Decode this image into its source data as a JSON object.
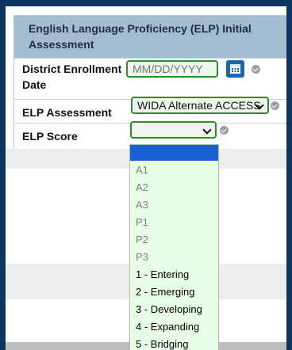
{
  "section": {
    "title": "English Language Proficiency (ELP) Initial Assessment"
  },
  "fields": {
    "enrollment_date": {
      "label": "District Enrollment Date",
      "value": "",
      "placeholder": "MM/DD/YYYY"
    },
    "elp_assessment": {
      "label": "ELP Assessment",
      "value": "WIDA Alternate ACCESS"
    },
    "elp_score": {
      "label": "ELP Score",
      "value": ""
    }
  },
  "dropdown": {
    "options": [
      {
        "label": "",
        "selected": true
      },
      {
        "label": "A1"
      },
      {
        "label": "A2"
      },
      {
        "label": "A3"
      },
      {
        "label": "P1"
      },
      {
        "label": "P2"
      },
      {
        "label": "P3"
      },
      {
        "label": "1 - Entering"
      },
      {
        "label": "2 - Emerging"
      },
      {
        "label": "3 - Developing"
      },
      {
        "label": "4 - Expanding"
      },
      {
        "label": "5 - Bridging"
      }
    ]
  },
  "colors": {
    "frame": "#0d3560",
    "header_bg": "#a3bccf",
    "field_border": "#2e8b2e",
    "dropdown_bg": "#e7ffe7",
    "selected_option": "#1a5fd6",
    "calendar_button": "#1e64b4"
  },
  "icons": {
    "calendar": "calendar-icon",
    "check": "check-circle-icon",
    "chevron": "chevron-down-icon"
  }
}
